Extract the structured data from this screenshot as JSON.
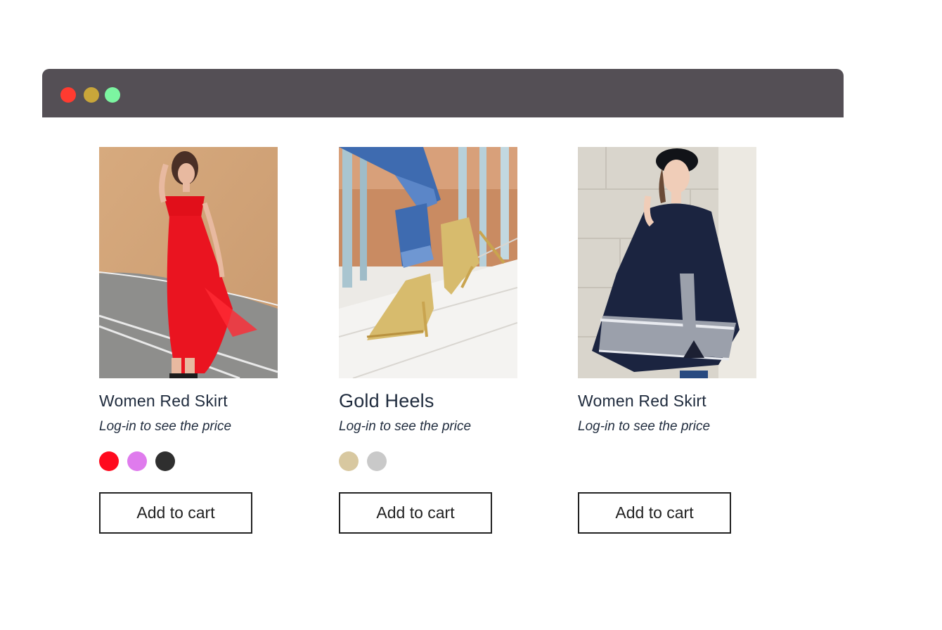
{
  "window": {
    "controls": [
      {
        "name": "close",
        "color": "#ff3b30"
      },
      {
        "name": "minimize",
        "color": "#c9a63a"
      },
      {
        "name": "maximize",
        "color": "#7cf5a1"
      }
    ]
  },
  "products": [
    {
      "name": "Women Red Skirt",
      "price_note": "Log-in to see the price",
      "swatches": [
        "#ff0a1e",
        "#df7bed",
        "#2f2f2f"
      ],
      "button_label": "Add to cart"
    },
    {
      "name": "Gold Heels",
      "price_note": "Log-in to see the price",
      "swatches": [
        "#d8c8a0",
        "#c9c9c9"
      ],
      "button_label": "Add to cart"
    },
    {
      "name": "Women Red Skirt",
      "price_note": "Log-in to see the price",
      "swatches": [],
      "button_label": "Add to cart"
    }
  ]
}
